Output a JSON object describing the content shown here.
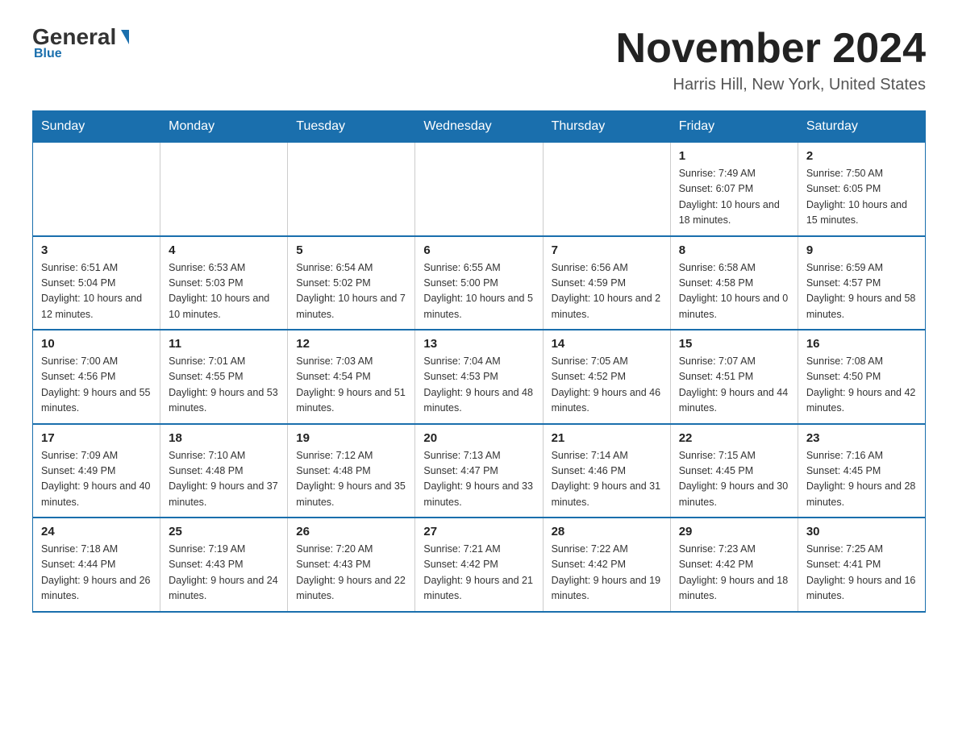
{
  "header": {
    "logo_general": "General",
    "logo_blue": "Blue",
    "month_title": "November 2024",
    "location": "Harris Hill, New York, United States"
  },
  "days_header": [
    "Sunday",
    "Monday",
    "Tuesday",
    "Wednesday",
    "Thursday",
    "Friday",
    "Saturday"
  ],
  "weeks": [
    [
      {
        "day": "",
        "info": ""
      },
      {
        "day": "",
        "info": ""
      },
      {
        "day": "",
        "info": ""
      },
      {
        "day": "",
        "info": ""
      },
      {
        "day": "",
        "info": ""
      },
      {
        "day": "1",
        "info": "Sunrise: 7:49 AM\nSunset: 6:07 PM\nDaylight: 10 hours and 18 minutes."
      },
      {
        "day": "2",
        "info": "Sunrise: 7:50 AM\nSunset: 6:05 PM\nDaylight: 10 hours and 15 minutes."
      }
    ],
    [
      {
        "day": "3",
        "info": "Sunrise: 6:51 AM\nSunset: 5:04 PM\nDaylight: 10 hours and 12 minutes."
      },
      {
        "day": "4",
        "info": "Sunrise: 6:53 AM\nSunset: 5:03 PM\nDaylight: 10 hours and 10 minutes."
      },
      {
        "day": "5",
        "info": "Sunrise: 6:54 AM\nSunset: 5:02 PM\nDaylight: 10 hours and 7 minutes."
      },
      {
        "day": "6",
        "info": "Sunrise: 6:55 AM\nSunset: 5:00 PM\nDaylight: 10 hours and 5 minutes."
      },
      {
        "day": "7",
        "info": "Sunrise: 6:56 AM\nSunset: 4:59 PM\nDaylight: 10 hours and 2 minutes."
      },
      {
        "day": "8",
        "info": "Sunrise: 6:58 AM\nSunset: 4:58 PM\nDaylight: 10 hours and 0 minutes."
      },
      {
        "day": "9",
        "info": "Sunrise: 6:59 AM\nSunset: 4:57 PM\nDaylight: 9 hours and 58 minutes."
      }
    ],
    [
      {
        "day": "10",
        "info": "Sunrise: 7:00 AM\nSunset: 4:56 PM\nDaylight: 9 hours and 55 minutes."
      },
      {
        "day": "11",
        "info": "Sunrise: 7:01 AM\nSunset: 4:55 PM\nDaylight: 9 hours and 53 minutes."
      },
      {
        "day": "12",
        "info": "Sunrise: 7:03 AM\nSunset: 4:54 PM\nDaylight: 9 hours and 51 minutes."
      },
      {
        "day": "13",
        "info": "Sunrise: 7:04 AM\nSunset: 4:53 PM\nDaylight: 9 hours and 48 minutes."
      },
      {
        "day": "14",
        "info": "Sunrise: 7:05 AM\nSunset: 4:52 PM\nDaylight: 9 hours and 46 minutes."
      },
      {
        "day": "15",
        "info": "Sunrise: 7:07 AM\nSunset: 4:51 PM\nDaylight: 9 hours and 44 minutes."
      },
      {
        "day": "16",
        "info": "Sunrise: 7:08 AM\nSunset: 4:50 PM\nDaylight: 9 hours and 42 minutes."
      }
    ],
    [
      {
        "day": "17",
        "info": "Sunrise: 7:09 AM\nSunset: 4:49 PM\nDaylight: 9 hours and 40 minutes."
      },
      {
        "day": "18",
        "info": "Sunrise: 7:10 AM\nSunset: 4:48 PM\nDaylight: 9 hours and 37 minutes."
      },
      {
        "day": "19",
        "info": "Sunrise: 7:12 AM\nSunset: 4:48 PM\nDaylight: 9 hours and 35 minutes."
      },
      {
        "day": "20",
        "info": "Sunrise: 7:13 AM\nSunset: 4:47 PM\nDaylight: 9 hours and 33 minutes."
      },
      {
        "day": "21",
        "info": "Sunrise: 7:14 AM\nSunset: 4:46 PM\nDaylight: 9 hours and 31 minutes."
      },
      {
        "day": "22",
        "info": "Sunrise: 7:15 AM\nSunset: 4:45 PM\nDaylight: 9 hours and 30 minutes."
      },
      {
        "day": "23",
        "info": "Sunrise: 7:16 AM\nSunset: 4:45 PM\nDaylight: 9 hours and 28 minutes."
      }
    ],
    [
      {
        "day": "24",
        "info": "Sunrise: 7:18 AM\nSunset: 4:44 PM\nDaylight: 9 hours and 26 minutes."
      },
      {
        "day": "25",
        "info": "Sunrise: 7:19 AM\nSunset: 4:43 PM\nDaylight: 9 hours and 24 minutes."
      },
      {
        "day": "26",
        "info": "Sunrise: 7:20 AM\nSunset: 4:43 PM\nDaylight: 9 hours and 22 minutes."
      },
      {
        "day": "27",
        "info": "Sunrise: 7:21 AM\nSunset: 4:42 PM\nDaylight: 9 hours and 21 minutes."
      },
      {
        "day": "28",
        "info": "Sunrise: 7:22 AM\nSunset: 4:42 PM\nDaylight: 9 hours and 19 minutes."
      },
      {
        "day": "29",
        "info": "Sunrise: 7:23 AM\nSunset: 4:42 PM\nDaylight: 9 hours and 18 minutes."
      },
      {
        "day": "30",
        "info": "Sunrise: 7:25 AM\nSunset: 4:41 PM\nDaylight: 9 hours and 16 minutes."
      }
    ]
  ]
}
